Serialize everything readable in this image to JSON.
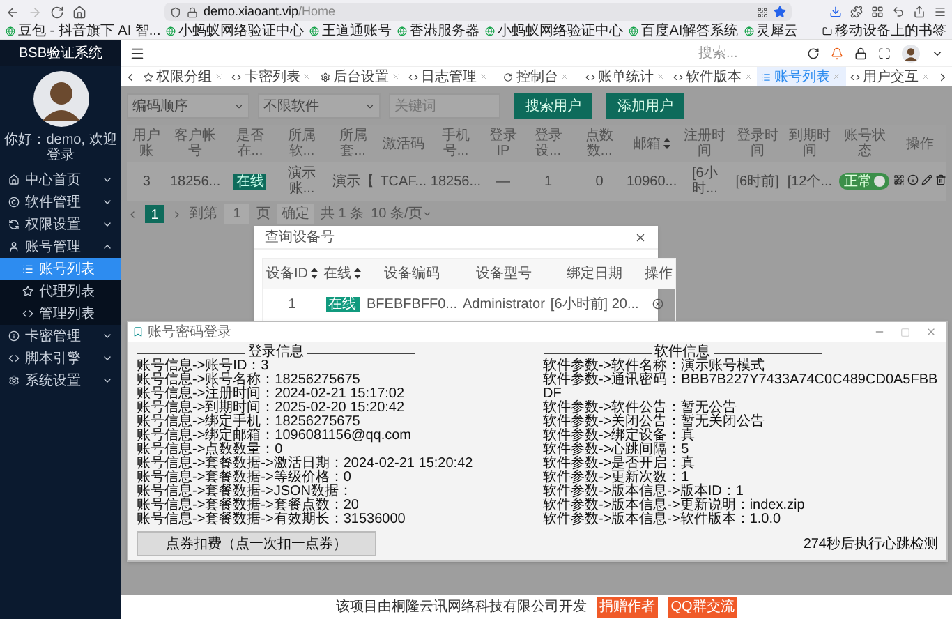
{
  "browser": {
    "url_host": "demo.xiaoant.vip",
    "url_path": "/Home",
    "bookmarks": [
      "豆包 - 抖音旗下 AI 智...",
      "小蚂蚁网络验证中心",
      "王道通账号",
      "香港服务器",
      "小蚂蚁网络验证中心",
      "百度AI解答系统",
      "灵犀云"
    ],
    "mobile_bookmarks": "移动设备上的书签"
  },
  "sidebar": {
    "title": "BSB验证系统",
    "greeting": "你好：demo, 欢迎登录",
    "items": [
      {
        "label": "中心首页",
        "expanded": false
      },
      {
        "label": "软件管理",
        "expanded": false
      },
      {
        "label": "权限设置",
        "expanded": false
      },
      {
        "label": "账号管理",
        "expanded": true,
        "children": [
          {
            "label": "账号列表",
            "selected": true
          },
          {
            "label": "代理列表",
            "selected": false
          },
          {
            "label": "管理列表",
            "selected": false
          }
        ]
      },
      {
        "label": "卡密管理",
        "expanded": false
      },
      {
        "label": "脚本引擎",
        "expanded": false
      },
      {
        "label": "系统设置",
        "expanded": false
      }
    ]
  },
  "header": {
    "search_placeholder": "搜索..."
  },
  "tabs": [
    {
      "label": "权限分组",
      "selected": false
    },
    {
      "label": "卡密列表",
      "selected": false
    },
    {
      "label": "后台设置",
      "selected": false
    },
    {
      "label": "日志管理",
      "selected": false
    },
    {
      "label": "控制台",
      "selected": false
    },
    {
      "label": "账单统计",
      "selected": false
    },
    {
      "label": "软件版本",
      "selected": false
    },
    {
      "label": "账号列表",
      "selected": true
    },
    {
      "label": "用户交互",
      "selected": false
    }
  ],
  "filters": {
    "order": "编码顺序",
    "software": "不限软件",
    "keyword_placeholder": "关键词",
    "buttons": [
      "搜索用户",
      "添加用户"
    ]
  },
  "table": {
    "columns": [
      {
        "label": "用户账",
        "sortable": false
      },
      {
        "label": "客户帐号",
        "sortable": false
      },
      {
        "label": "是否在...",
        "sortable": false
      },
      {
        "label": "所属软...",
        "sortable": false
      },
      {
        "label": "所属套...",
        "sortable": false
      },
      {
        "label": "激活码",
        "sortable": false
      },
      {
        "label": "手机号...",
        "sortable": false
      },
      {
        "label": "登录IP",
        "sortable": false
      },
      {
        "label": "登录设...",
        "sortable": false
      },
      {
        "label": "点数数...",
        "sortable": false
      },
      {
        "label": "邮箱",
        "sortable": true
      },
      {
        "label": "注册时间",
        "sortable": false
      },
      {
        "label": "登录时间",
        "sortable": false
      },
      {
        "label": "到期时间",
        "sortable": false
      },
      {
        "label": "账号状态",
        "sortable": false
      },
      {
        "label": "操作",
        "sortable": false
      }
    ],
    "rows": [
      {
        "cells": [
          {
            "kind": "text",
            "text": "3"
          },
          {
            "kind": "text",
            "text": "18256..."
          },
          {
            "kind": "badge",
            "text": "在线"
          },
          {
            "kind": "text",
            "text": "演示账..."
          },
          {
            "kind": "text",
            "text": "演示【"
          },
          {
            "kind": "text",
            "text": "TCAF..."
          },
          {
            "kind": "text",
            "text": "18256..."
          },
          {
            "kind": "text",
            "text": "—"
          },
          {
            "kind": "text",
            "text": "1"
          },
          {
            "kind": "text",
            "text": "0"
          },
          {
            "kind": "text",
            "text": "10960..."
          },
          {
            "kind": "text",
            "text": "[6小时..."
          },
          {
            "kind": "text",
            "text": "[6时前]"
          },
          {
            "kind": "text",
            "text": "[12个..."
          },
          {
            "kind": "toggle",
            "text": "正常",
            "on": true
          },
          {
            "kind": "actions"
          }
        ]
      }
    ]
  },
  "pagination": {
    "pages": [
      {
        "label": "1",
        "selected": true
      }
    ],
    "goto_label": "到第",
    "goto_value": "1",
    "page_unit": "页",
    "confirm": "确定",
    "total": "共 1 条",
    "page_size": "10 条/页"
  },
  "dialog": {
    "title": "查询设备号",
    "columns": [
      {
        "label": "设备ID",
        "sortable": true
      },
      {
        "label": "在线",
        "sortable": true
      },
      {
        "label": "设备编码",
        "sortable": false
      },
      {
        "label": "设备型号",
        "sortable": false
      },
      {
        "label": "绑定日期",
        "sortable": false
      },
      {
        "label": "操作",
        "sortable": false
      }
    ],
    "rows": [
      {
        "cells": [
          {
            "kind": "text",
            "text": "1"
          },
          {
            "kind": "badge",
            "text": "在线"
          },
          {
            "kind": "text",
            "text": "BFEBFBFF0..."
          },
          {
            "kind": "text",
            "text": "Administrator"
          },
          {
            "kind": "text",
            "text": "[6小时前] 20..."
          },
          {
            "kind": "actions"
          }
        ]
      }
    ]
  },
  "window": {
    "title": "账号密码登录",
    "sections": [
      {
        "heading": "登录信息",
        "lines": [
          "账号信息->账号ID：3",
          "账号信息->账号名称：18256275675",
          "账号信息->注册时间：2024-02-21 15:17:02",
          "账号信息->到期时间：2025-02-20 15:20:42",
          "账号信息->绑定手机：18256275675",
          "账号信息->绑定邮箱：1096081156@qq.com",
          "账号信息->点数数量：0",
          "账号信息->套餐数据->激活日期：2024-02-21 15:20:42",
          "账号信息->套餐数据->等级价格：0",
          "账号信息->套餐数据->JSON数据：",
          "账号信息->套餐数据->套餐点数：20",
          "账号信息->套餐数据->有效期长：31536000"
        ]
      },
      {
        "heading": "软件信息",
        "lines": [
          "软件参数->软件名称：演示账号模式",
          "软件参数->通讯密码：BBB7B227Y7433A74C0C489CD0A5FBBDF",
          "软件参数->软件公告：暂无公告",
          "软件参数->关闭公告：暂无关闭公告",
          "软件参数->绑定设备：真",
          "软件参数->心跳间隔：5",
          "软件参数->是否开启：真",
          "软件参数->更新次数：1",
          "软件参数->版本信息->版本ID：1",
          "软件参数->版本信息->更新说明：index.zip",
          "软件参数->版本信息->软件版本：1.0.0"
        ]
      }
    ],
    "button": "点券扣费（点一次扣一点券）",
    "heartbeat": "274秒后执行心跳检测"
  },
  "footer": {
    "text": "该项目由桐隆云讯网络科技有限公司开发",
    "badges": [
      "捐赠作者",
      "QQ群交流"
    ]
  }
}
